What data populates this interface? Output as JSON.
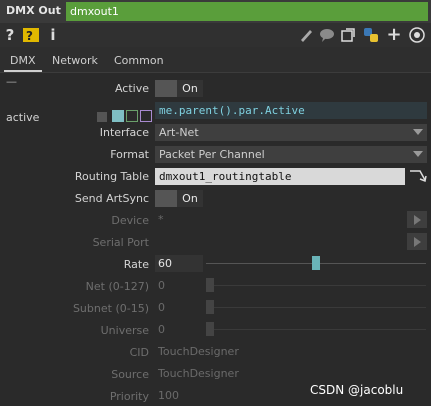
{
  "header": {
    "op_type": "DMX Out",
    "op_name": "dmxout1"
  },
  "toolbar": {
    "help": "?",
    "info": "i",
    "add": "+"
  },
  "tabs": [
    "DMX",
    "Network",
    "Common"
  ],
  "params": {
    "active": {
      "label": "Active",
      "value": "On"
    },
    "active_expr": {
      "label": "active",
      "expr": "me.parent().par.Active"
    },
    "interface": {
      "label": "Interface",
      "value": "Art-Net"
    },
    "format": {
      "label": "Format",
      "value": "Packet Per Channel"
    },
    "routing_table": {
      "label": "Routing Table",
      "value": "dmxout1_routingtable"
    },
    "send_artsync": {
      "label": "Send ArtSync",
      "value": "On"
    },
    "device": {
      "label": "Device",
      "value": "*"
    },
    "serial_port": {
      "label": "Serial Port",
      "value": ""
    },
    "rate": {
      "label": "Rate",
      "value": "60",
      "level": 0.5
    },
    "net": {
      "label": "Net (0-127)",
      "value": "0"
    },
    "subnet": {
      "label": "Subnet (0-15)",
      "value": "0"
    },
    "universe": {
      "label": "Universe",
      "value": "0"
    },
    "cid": {
      "label": "CID",
      "value": "TouchDesigner"
    },
    "source": {
      "label": "Source",
      "value": "TouchDesigner"
    },
    "priority": {
      "label": "Priority",
      "value": "100"
    }
  },
  "watermark": "CSDN @jacoblu",
  "colors": {
    "name_bar": "#5a9e3b",
    "expr_text": "#7fd1e0",
    "slider": "#6ab4b8"
  }
}
